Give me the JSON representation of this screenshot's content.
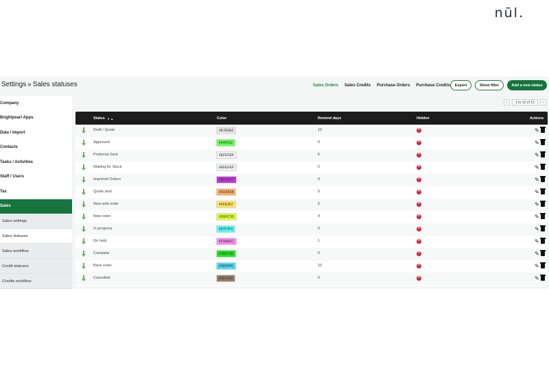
{
  "brand": {
    "logo_text": "nūl."
  },
  "breadcrumb": {
    "parent": "Settings",
    "separator": "»",
    "current": "Sales statuses"
  },
  "nav": {
    "tabs": [
      {
        "label": "Sales Orders",
        "active": true
      },
      {
        "label": "Sales Credits",
        "active": false
      },
      {
        "label": "Purchase Orders",
        "active": false
      },
      {
        "label": "Purchase Credits",
        "active": false
      }
    ],
    "export_label": "Export",
    "show_filter_label": "Show filter",
    "add_label": "Add a new status"
  },
  "sidebar": {
    "items": [
      {
        "label": "Company"
      },
      {
        "label": "Brightpearl Apps"
      },
      {
        "label": "Data / Import"
      },
      {
        "label": "Contacts"
      },
      {
        "label": "Tasks / Activities"
      },
      {
        "label": "Staff / Users"
      },
      {
        "label": "Tax"
      },
      {
        "label": "Sales"
      }
    ],
    "sub_items": [
      {
        "label": "Sales settings"
      },
      {
        "label": "Sales statuses"
      },
      {
        "label": "Sales workflow"
      },
      {
        "label": "Credit statuses"
      },
      {
        "label": "Credits workflow"
      }
    ]
  },
  "pager": {
    "prev": "‹",
    "text": "1 to 13 of 13",
    "next": "›"
  },
  "table": {
    "headers": {
      "status": "Status",
      "sort": "▼ ▲",
      "color": "Color",
      "remind": "Remind days",
      "hidden": "Hidden",
      "actions": "Actions"
    },
    "rows": [
      {
        "status": "Draft / Quote",
        "color": "#E7E6E6",
        "remind": "10"
      },
      {
        "status": "Approved",
        "color": "#64FF52",
        "remind": "0"
      },
      {
        "status": "Proforma Sent",
        "color": "#EFEFEF",
        "remind": "6"
      },
      {
        "status": "Waiting for Stock",
        "color": "#EFEFEF",
        "remind": "0"
      },
      {
        "status": "Imported Orders",
        "color": "#BF3AD7",
        "remind": "0"
      },
      {
        "status": "Quote sent",
        "color": "#FDAF68",
        "remind": "5"
      },
      {
        "status": "New web order",
        "color": "#FFE257",
        "remind": "5"
      },
      {
        "status": "New order",
        "color": "#DEFC35",
        "remind": "4"
      },
      {
        "status": "In progress",
        "color": "#57F7F4",
        "remind": "0"
      },
      {
        "status": "On hold",
        "color": "#F98AEC",
        "remind": "1"
      },
      {
        "status": "Complete",
        "color": "#1EE71E",
        "remind": "0"
      },
      {
        "status": "Back order",
        "color": "#49D9F6",
        "remind": "10"
      },
      {
        "status": "Cancelled",
        "color": "#967D66",
        "remind": "0"
      }
    ]
  },
  "colors": {
    "accent": "#15753d",
    "header_bg": "#1c1c1c",
    "hidden_icon": "#d2233f"
  }
}
